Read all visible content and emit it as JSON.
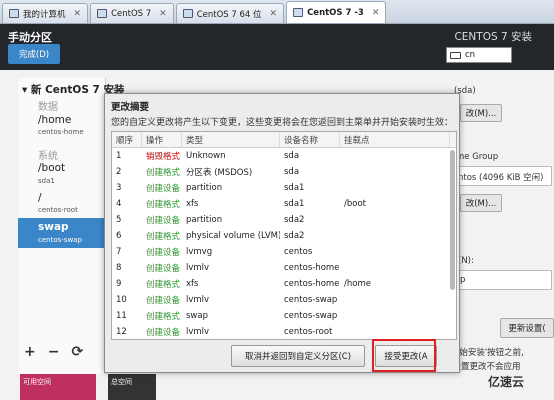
{
  "vm_tabs": [
    {
      "label": "我的计算机",
      "active": false
    },
    {
      "label": "CentOS 7",
      "active": false
    },
    {
      "label": "CentOS 7 64 位",
      "active": false
    },
    {
      "label": "CentOS 7 -3",
      "active": true
    }
  ],
  "header": {
    "title": "手动分区",
    "done_label": "完成(D)",
    "os_title": "CENTOS 7 安装",
    "keyboard": "cn"
  },
  "left_panel": {
    "install_title": "▾ 新 CentOS 7 安装",
    "data_section": "数据",
    "system_section": "系统",
    "entries": [
      {
        "mount": "/home",
        "device": "centos-home"
      },
      {
        "mount": "/boot",
        "device": "sda1"
      },
      {
        "mount": "/",
        "device": "centos-root"
      },
      {
        "mount": "swap",
        "device": "centos-swap"
      }
    ],
    "tools": [
      "+",
      "−",
      "⟳"
    ],
    "available_label": "可用空间",
    "total_label": "总空间"
  },
  "right_fragments": {
    "device_label": "(sda)",
    "modify1": "改(M)...",
    "volume_group": "me Group",
    "vg_value": "ntos    (4096 KiB 空闲)",
    "modify2": "改(M)...",
    "name_label": "(N):",
    "name_value": "p",
    "update_btn": "更新设置(",
    "hint1": "在'开始安装'按钮之前,",
    "hint2": "的设置更改不会应用"
  },
  "dialog": {
    "title": "更改摘要",
    "description": "您的自定义更改将产生以下变更，这些变更将会在您返回到主菜单并开始安装时生效：",
    "columns": [
      "顺序",
      "操作",
      "类型",
      "设备名称",
      "挂载点"
    ],
    "rows": [
      {
        "order": "1",
        "action": "销毁格式",
        "type": "Unknown",
        "device": "sda",
        "mount": ""
      },
      {
        "order": "2",
        "action": "创建格式",
        "type": "分区表 (MSDOS)",
        "device": "sda",
        "mount": ""
      },
      {
        "order": "3",
        "action": "创建设备",
        "type": "partition",
        "device": "sda1",
        "mount": ""
      },
      {
        "order": "4",
        "action": "创建格式",
        "type": "xfs",
        "device": "sda1",
        "mount": "/boot"
      },
      {
        "order": "5",
        "action": "创建设备",
        "type": "partition",
        "device": "sda2",
        "mount": ""
      },
      {
        "order": "6",
        "action": "创建格式",
        "type": "physical volume (LVM)",
        "device": "sda2",
        "mount": ""
      },
      {
        "order": "7",
        "action": "创建设备",
        "type": "lvmvg",
        "device": "centos",
        "mount": ""
      },
      {
        "order": "8",
        "action": "创建设备",
        "type": "lvmlv",
        "device": "centos-home",
        "mount": ""
      },
      {
        "order": "9",
        "action": "创建格式",
        "type": "xfs",
        "device": "centos-home",
        "mount": "/home"
      },
      {
        "order": "10",
        "action": "创建设备",
        "type": "lvmlv",
        "device": "centos-swap",
        "mount": ""
      },
      {
        "order": "11",
        "action": "创建格式",
        "type": "swap",
        "device": "centos-swap",
        "mount": ""
      },
      {
        "order": "12",
        "action": "创建设备",
        "type": "lvmlv",
        "device": "centos-root",
        "mount": ""
      }
    ],
    "cancel_label": "取消并返回到自定义分区(C)",
    "accept_label": "接受更改(A"
  },
  "watermark": "亿速云",
  "colors": {
    "destroy": "#cc0000",
    "create": "#2a9a2a",
    "accent": "#3a86c8",
    "highlight": "#e02020"
  }
}
